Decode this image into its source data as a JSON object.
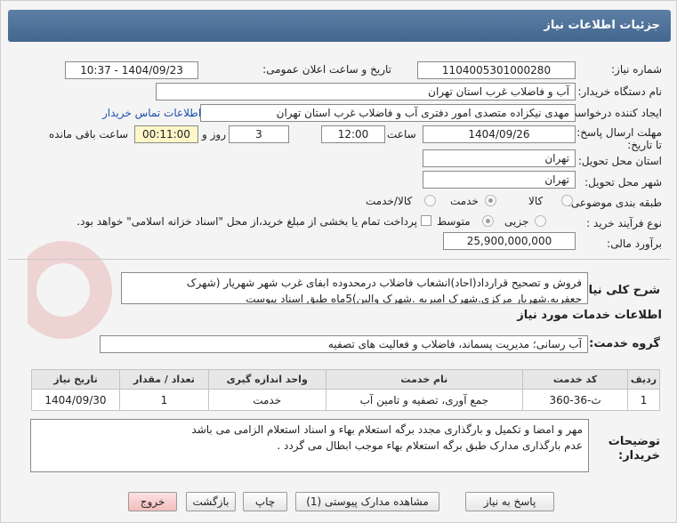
{
  "header": {
    "title": "جزئیات اطلاعات نیاز"
  },
  "fields": {
    "need_number_label": "شماره نیاز:",
    "need_number": "1104005301000280",
    "announce_label": "تاریخ و ساعت اعلان عمومی:",
    "announce_value": "1404/09/23 - 10:37",
    "buyer_org_label": "نام دستگاه خریدار:",
    "buyer_org": "آب و فاضلاب غرب استان تهران",
    "creator_label": "ایجاد کننده درخواست:",
    "creator": "مهدی نیکزاده متصدی امور دفتری آب و فاضلاب غرب استان تهران",
    "contact_link": "اطلاعات تماس خریدار",
    "deadline_label": "مهلت ارسال پاسخ: تا تاریخ:",
    "deadline_date": "1404/09/26",
    "time_label": "ساعت",
    "deadline_time": "12:00",
    "days_value": "3",
    "days_label": "روز و",
    "remaining_time": "00:11:00",
    "remaining_label": "ساعت باقی مانده",
    "province_label": "استان محل تحویل:",
    "province": "تهران",
    "city_label": "شهر محل تحویل:",
    "city": "تهران",
    "category_label": "طبقه بندی موضوعی:",
    "category_options": [
      "کالا",
      "خدمت",
      "کالا/خدمت"
    ],
    "category_selected": "خدمت",
    "process_label": "نوع فرآیند خرید :",
    "process_options": [
      "جزیی",
      "متوسط"
    ],
    "process_selected": "متوسط",
    "payment_note": "پرداخت تمام یا بخشی از مبلغ خرید،از محل \"اسناد خزانه اسلامی\" خواهد بود.",
    "estimate_label": "برآورد مالی:",
    "estimate": "25,900,000,000"
  },
  "summary": {
    "label": "شرح کلی نیاز:",
    "text": "فروش و تصحیح قرارداد(احاد)انشعاب فاضلاب درمحدوده ابفای غرب شهر شهریار (شهرک جعفریه.شهریار مرکزی.شهرک امیریه .شهرک والین)5ماه طبق اسناد پیوست"
  },
  "services": {
    "section_title": "اطلاعات خدمات مورد نیاز",
    "group_label": "گروه خدمت:",
    "group_value": "آب رسانی؛ مدیریت پسماند، فاضلاب و فعالیت های تصفیه",
    "columns": [
      "ردیف",
      "کد خدمت",
      "نام خدمت",
      "واحد اندازه گیری",
      "تعداد / مقدار",
      "تاریخ نیاز"
    ],
    "rows": [
      [
        "1",
        "ث-36-360",
        "جمع آوری، تصفیه و تامین آب",
        "خدمت",
        "1",
        "1404/09/30"
      ]
    ]
  },
  "buyer_notes": {
    "label": "توضیحات خریدار:",
    "line1": "مهر و امضا و تکمیل و بارگذاری مجدد برگه استعلام بهاء و اسناد استعلام الزامی می باشد",
    "line2": "عدم بارگذاری مدارک طبق برگه استعلام بهاء موجب ابطال می گردد ."
  },
  "buttons": {
    "respond": "پاسخ به نیاز",
    "attachments": "مشاهده مدارک پیوستی (1)",
    "print": "چاپ",
    "back": "بازگشت",
    "exit": "خروج"
  },
  "colors": {
    "title_bar": "#4f7299",
    "link": "#1b4fb0",
    "exit_button": "#f3bcbc",
    "remaining_bg": "#fff7c8"
  }
}
